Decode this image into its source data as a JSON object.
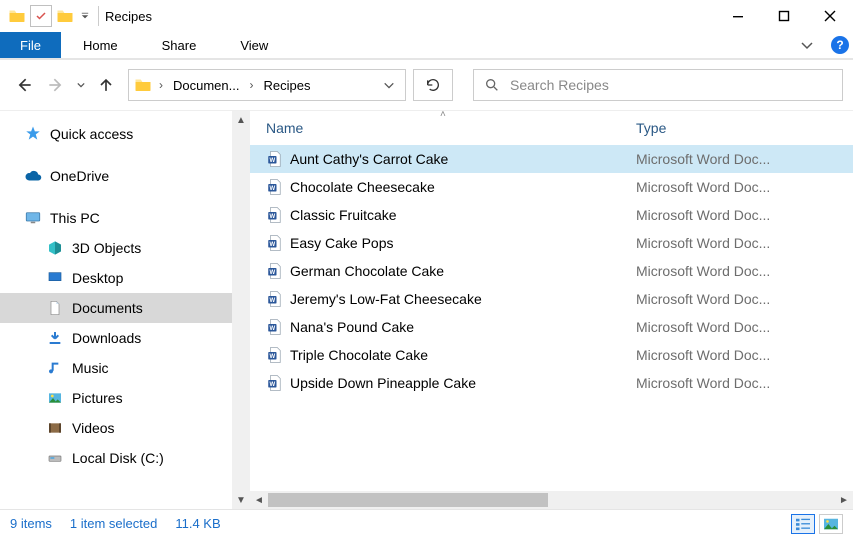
{
  "window": {
    "title": "Recipes"
  },
  "ribbon": {
    "file": "File",
    "tabs": [
      "Home",
      "Share",
      "View"
    ]
  },
  "breadcrumb": {
    "items": [
      "Documen...",
      "Recipes"
    ]
  },
  "search": {
    "placeholder": "Search Recipes"
  },
  "sidebar": {
    "quick_access": "Quick access",
    "onedrive": "OneDrive",
    "this_pc": "This PC",
    "items": [
      {
        "label": "3D Objects"
      },
      {
        "label": "Desktop"
      },
      {
        "label": "Documents",
        "selected": true
      },
      {
        "label": "Downloads"
      },
      {
        "label": "Music"
      },
      {
        "label": "Pictures"
      },
      {
        "label": "Videos"
      },
      {
        "label": "Local Disk (C:)"
      }
    ]
  },
  "columns": {
    "name": "Name",
    "type": "Type"
  },
  "files": [
    {
      "name": "Aunt Cathy's Carrot Cake",
      "type": "Microsoft Word Doc...",
      "selected": true
    },
    {
      "name": "Chocolate Cheesecake",
      "type": "Microsoft Word Doc..."
    },
    {
      "name": "Classic Fruitcake",
      "type": "Microsoft Word Doc..."
    },
    {
      "name": "Easy Cake Pops",
      "type": "Microsoft Word Doc..."
    },
    {
      "name": "German Chocolate Cake",
      "type": "Microsoft Word Doc..."
    },
    {
      "name": "Jeremy's Low-Fat Cheesecake",
      "type": "Microsoft Word Doc..."
    },
    {
      "name": "Nana's Pound Cake",
      "type": "Microsoft Word Doc..."
    },
    {
      "name": "Triple Chocolate Cake",
      "type": "Microsoft Word Doc..."
    },
    {
      "name": "Upside Down Pineapple Cake",
      "type": "Microsoft Word Doc..."
    }
  ],
  "status": {
    "count": "9 items",
    "selection": "1 item selected",
    "size": "11.4 KB"
  }
}
